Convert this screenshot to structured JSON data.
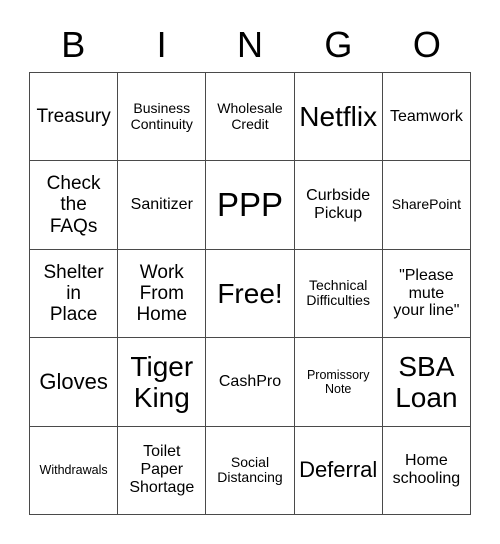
{
  "card": {
    "header": {
      "letters": [
        "B",
        "I",
        "N",
        "G",
        "O"
      ]
    },
    "grid": {
      "rows": [
        [
          {
            "text": "Treasury",
            "size": "l"
          },
          {
            "text": "Business\nContinuity",
            "size": "s"
          },
          {
            "text": "Wholesale\nCredit",
            "size": "s"
          },
          {
            "text": "Netflix",
            "size": "xxl"
          },
          {
            "text": "Teamwork",
            "size": "m"
          }
        ],
        [
          {
            "text": "Check\nthe\nFAQs",
            "size": "l"
          },
          {
            "text": "Sanitizer",
            "size": "m"
          },
          {
            "text": "PPP",
            "size": "huge"
          },
          {
            "text": "Curbside\nPickup",
            "size": "m"
          },
          {
            "text": "SharePoint",
            "size": "s"
          }
        ],
        [
          {
            "text": "Shelter\nin\nPlace",
            "size": "l"
          },
          {
            "text": "Work\nFrom\nHome",
            "size": "l"
          },
          {
            "text": "Free!",
            "size": "xxl"
          },
          {
            "text": "Technical\nDifficulties",
            "size": "s"
          },
          {
            "text": "\"Please\nmute\nyour line\"",
            "size": "m"
          }
        ],
        [
          {
            "text": "Gloves",
            "size": "xl"
          },
          {
            "text": "Tiger\nKing",
            "size": "xxl"
          },
          {
            "text": "CashPro",
            "size": "m"
          },
          {
            "text": "Promissory\nNote",
            "size": "xs"
          },
          {
            "text": "SBA\nLoan",
            "size": "xxl"
          }
        ],
        [
          {
            "text": "Withdrawals",
            "size": "xs"
          },
          {
            "text": "Toilet\nPaper\nShortage",
            "size": "m"
          },
          {
            "text": "Social\nDistancing",
            "size": "s"
          },
          {
            "text": "Deferral",
            "size": "xl"
          },
          {
            "text": "Home\nschooling",
            "size": "m"
          }
        ]
      ]
    },
    "colors": {
      "background": "#ffffff",
      "text": "#000000",
      "grid_line": "#4a4a4a"
    }
  }
}
